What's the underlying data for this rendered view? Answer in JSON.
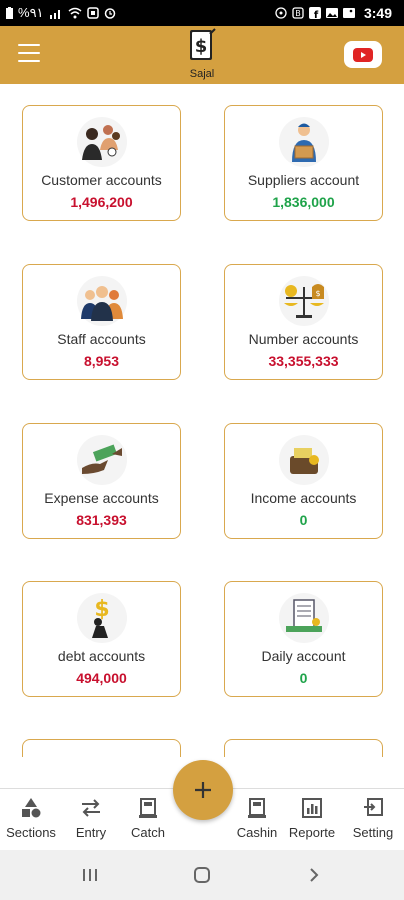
{
  "status_bar": {
    "left_text": "%٩١",
    "time": "3:49"
  },
  "app_bar": {
    "logo_text": "Sajal",
    "accent": "#d4a040"
  },
  "cards": [
    {
      "title": "Customer accounts",
      "value": "1,496,200",
      "value_color": "red",
      "icon": "customers-icon"
    },
    {
      "title": "Suppliers account",
      "value": "1,836,000",
      "value_color": "green",
      "icon": "delivery-person-icon"
    },
    {
      "title": "Staff accounts",
      "value": "8,953",
      "value_color": "red",
      "icon": "staff-group-icon"
    },
    {
      "title": "Number accounts",
      "value": "33,355,333",
      "value_color": "red",
      "icon": "balance-scale-icon"
    },
    {
      "title": "Expense accounts",
      "value": "831,393",
      "value_color": "red",
      "icon": "hand-money-icon"
    },
    {
      "title": "Income accounts",
      "value": "0",
      "value_color": "green",
      "icon": "wallet-icon"
    },
    {
      "title": "debt accounts",
      "value": "494,000",
      "value_color": "red",
      "icon": "debt-burden-icon"
    },
    {
      "title": "Daily account",
      "value": "0",
      "value_color": "green",
      "icon": "daily-report-icon"
    }
  ],
  "bottom_nav": {
    "sections": "Sections",
    "entry": "Entry",
    "catch": "Catch",
    "cashin": "Cashin",
    "reports": "Reporte",
    "setting": "Setting"
  },
  "colors": {
    "accent": "#d4a040",
    "card_border": "#d9a84e",
    "value_red": "#c8102e",
    "value_green": "#1fa34a"
  }
}
